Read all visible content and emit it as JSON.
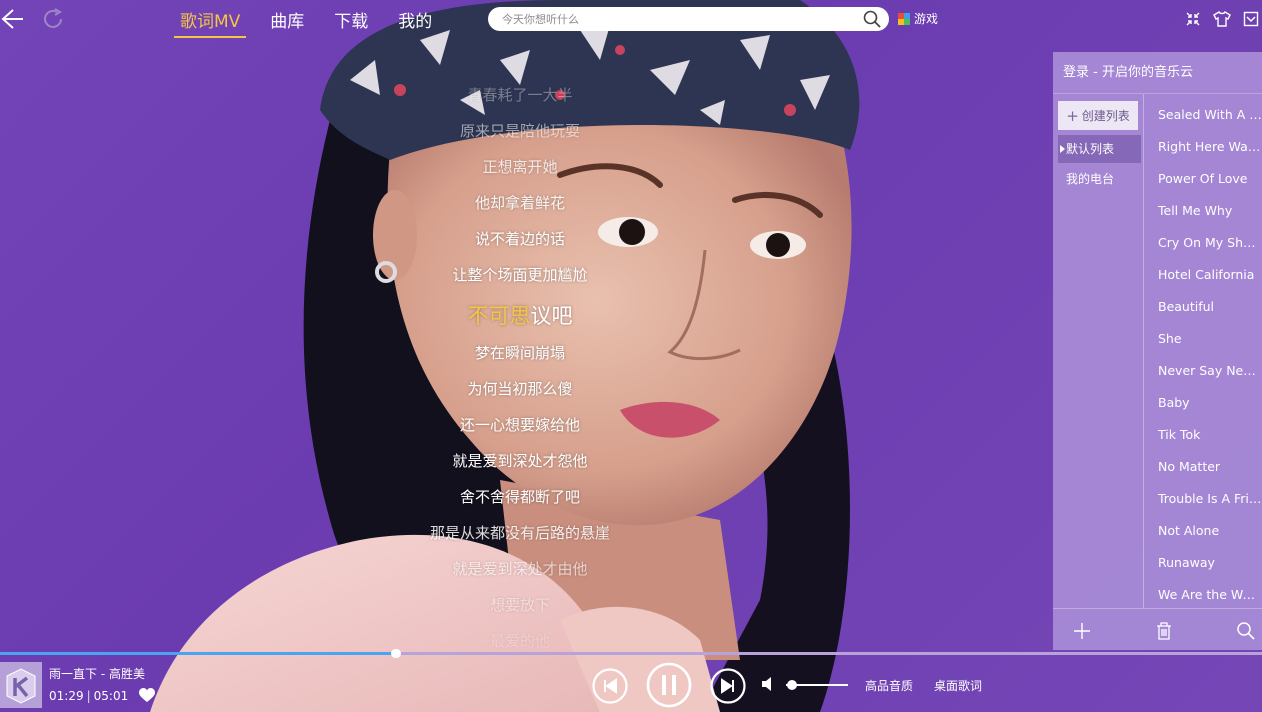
{
  "topbar": {
    "tabs": [
      {
        "label": "歌词MV",
        "active": true
      },
      {
        "label": "曲库",
        "active": false
      },
      {
        "label": "下载",
        "active": false
      },
      {
        "label": "我的",
        "active": false
      }
    ],
    "search_placeholder": "今天你想听什么",
    "games_label": "游戏"
  },
  "lyrics": {
    "lines": [
      "青春耗了一大半",
      "原来只是陪他玩耍",
      "正想离开她",
      "他却拿着鲜花",
      "说不着边的话",
      "让整个场面更加尴尬",
      "不可思议吧",
      "梦在瞬间崩塌",
      "为何当初那么傻",
      "还一心想要嫁给他",
      "就是爱到深处才怨他",
      "舍不舍得都断了吧",
      "那是从来都没有后路的悬崖",
      "就是爱到深处才由他",
      "想要放下",
      "最爱的他"
    ],
    "current_index": 6,
    "current_sung": "不可思",
    "current_rest": "议吧"
  },
  "panel": {
    "header": "登录 - 开启你的音乐云",
    "create_label": "创建列表",
    "playlists": [
      {
        "label": "默认列表",
        "active": true
      },
      {
        "label": "我的电台",
        "active": false
      }
    ],
    "songs": [
      "Sealed With A Kiss",
      "Right Here Waiting",
      "Power Of Love",
      "Tell Me Why",
      "Cry On My Shoulder",
      "Hotel California",
      "Beautiful",
      "She",
      "Never Say Never",
      "Baby",
      "Tik Tok",
      "No Matter",
      "Trouble Is A Friend",
      "Not Alone",
      "Runaway",
      "We Are the World"
    ]
  },
  "player": {
    "title": "雨一直下 - 高胜美",
    "elapsed": "01:29",
    "duration": "05:01",
    "progress_fraction": 0.314,
    "volume_fraction": 0.1,
    "quality_label": "高品音质",
    "desktop_lyrics_label": "桌面歌词",
    "is_playing": true
  },
  "colors": {
    "accent": "#f6c544",
    "background": "#6b3cb0",
    "panel": "#a88cd6",
    "progress": "#4aa4f2"
  },
  "icons": [
    "back-arrow-icon",
    "refresh-icon",
    "search-icon",
    "games-icon",
    "shrink-icon",
    "skin-icon",
    "menu-dropdown-icon",
    "add-icon",
    "trash-icon",
    "search-icon",
    "heart-icon",
    "prev-icon",
    "pause-icon",
    "next-icon",
    "volume-icon"
  ]
}
